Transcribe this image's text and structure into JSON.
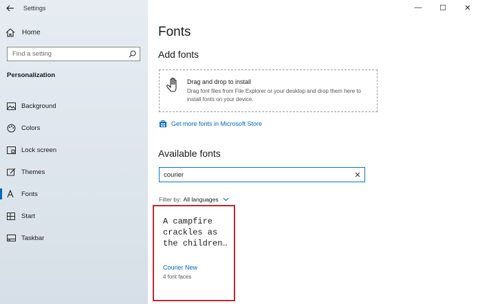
{
  "window": {
    "app_title": "Settings",
    "minimize": "—",
    "maximize": "☐",
    "close": "✕"
  },
  "sidebar": {
    "home_label": "Home",
    "search_placeholder": "Find a setting",
    "section_title": "Personalization",
    "items": [
      {
        "label": "Background",
        "icon": "image-icon"
      },
      {
        "label": "Colors",
        "icon": "palette-icon"
      },
      {
        "label": "Lock screen",
        "icon": "lock-screen-icon"
      },
      {
        "label": "Themes",
        "icon": "brush-icon"
      },
      {
        "label": "Fonts",
        "icon": "font-icon",
        "active": true
      },
      {
        "label": "Start",
        "icon": "start-grid-icon"
      },
      {
        "label": "Taskbar",
        "icon": "taskbar-icon"
      }
    ]
  },
  "main": {
    "title": "Fonts",
    "add_fonts_heading": "Add fonts",
    "drop_title": "Drag and drop to install",
    "drop_description": "Drag font files from File Explorer or your desktop and drop them here to install fonts on your device.",
    "store_link": "Get more fonts in Microsoft Store",
    "available_heading": "Available fonts",
    "font_search_value": "courier",
    "filter_label": "Filter by:",
    "filter_value": "All languages",
    "font_card": {
      "preview": "A campfire crackles as the children…",
      "name": "Courier New",
      "faces": "4 font faces"
    }
  },
  "colors": {
    "accent": "#0067c0",
    "highlight_border": "#c1272d"
  }
}
